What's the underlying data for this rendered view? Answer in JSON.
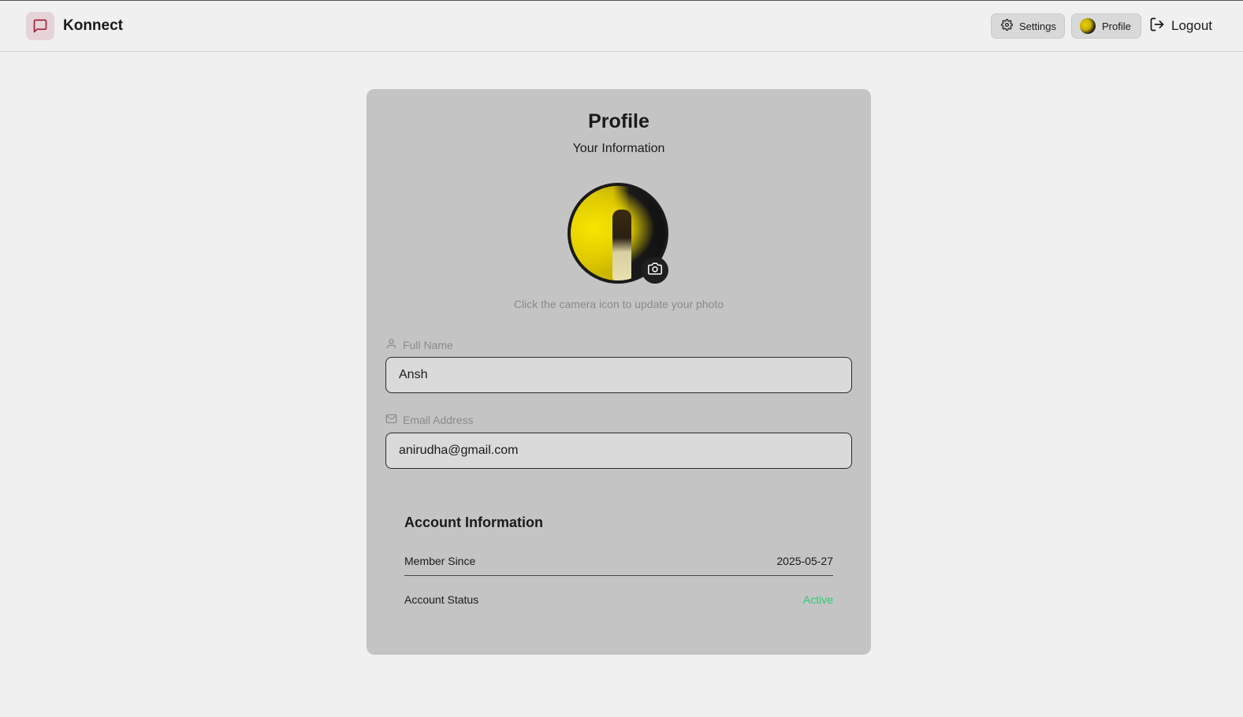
{
  "app": {
    "name": "Konnect"
  },
  "nav": {
    "settings_label": "Settings",
    "profile_label": "Profile",
    "logout_label": "Logout"
  },
  "profile": {
    "title": "Profile",
    "subtitle": "Your Information",
    "photo_hint": "Click the camera icon to update your photo"
  },
  "form": {
    "full_name": {
      "label": "Full Name",
      "value": "Ansh"
    },
    "email": {
      "label": "Email Address",
      "value": "anirudha@gmail.com"
    }
  },
  "account": {
    "title": "Account Information",
    "member_since": {
      "label": "Member Since",
      "value": "2025-05-27"
    },
    "status": {
      "label": "Account Status",
      "value": "Active"
    }
  },
  "colors": {
    "status_active": "#2ecc71",
    "card_bg": "#c4c4c4",
    "page_bg": "#f0f0f0",
    "brand_accent": "#a0203c"
  },
  "icons": {
    "brand": "message-square-icon",
    "settings": "gear-icon",
    "profile": "avatar",
    "logout": "log-out-icon",
    "camera": "camera-icon",
    "name": "user-icon",
    "email": "mail-icon"
  }
}
